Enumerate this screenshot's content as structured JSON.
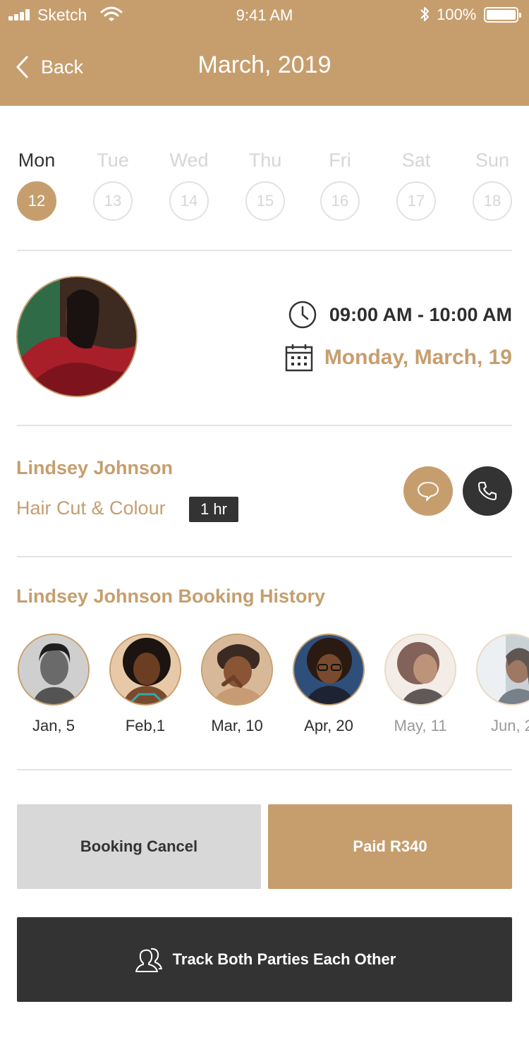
{
  "status_bar": {
    "carrier": "Sketch",
    "time": "9:41 AM",
    "battery": "100%"
  },
  "nav": {
    "back_label": "Back",
    "title": "March, 2019"
  },
  "week": [
    {
      "name": "Mon",
      "num": "12",
      "active": true
    },
    {
      "name": "Tue",
      "num": "13"
    },
    {
      "name": "Wed",
      "num": "14"
    },
    {
      "name": "Thu",
      "num": "15"
    },
    {
      "name": "Fri",
      "num": "16"
    },
    {
      "name": "Sat",
      "num": "17"
    },
    {
      "name": "Sun",
      "num": "18"
    }
  ],
  "appointment": {
    "time_range": "09:00 AM - 10:00 AM",
    "date": "Monday, March, 19"
  },
  "client": {
    "name": "Lindsey Johnson",
    "service": "Hair Cut & Colour",
    "duration": "1 hr"
  },
  "history": {
    "title": "Lindsey Johnson Booking History",
    "items": [
      {
        "date": "Jan, 5"
      },
      {
        "date": "Feb,1"
      },
      {
        "date": "Mar, 10"
      },
      {
        "date": "Apr, 20"
      },
      {
        "date": "May, 11"
      },
      {
        "date": "Jun, 2"
      }
    ]
  },
  "actions": {
    "cancel_label": "Booking Cancel",
    "paid_label": "Paid R340",
    "track_label": "Track Both Parties Each Other"
  },
  "colors": {
    "accent": "#c69e6e",
    "dark": "#333333",
    "light_gray": "#d8d8d8"
  }
}
